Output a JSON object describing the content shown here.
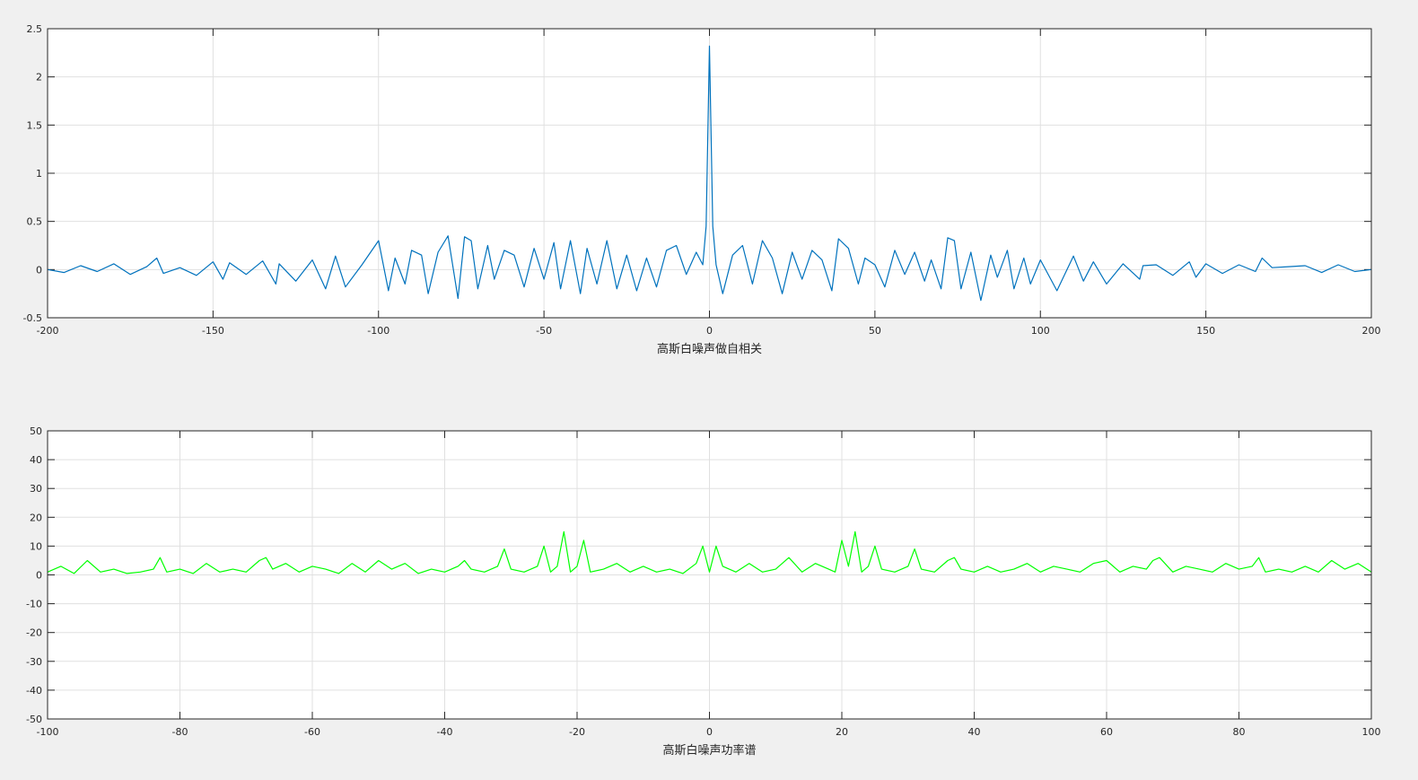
{
  "chart_data": [
    {
      "type": "line",
      "title": "",
      "xlabel": "高斯白噪声做自相关",
      "ylabel": "",
      "xlim": [
        -200,
        200
      ],
      "ylim": [
        -0.5,
        2.5
      ],
      "grid": true,
      "xticks": [
        "-200",
        "-150",
        "-100",
        "-50",
        "0",
        "50",
        "100",
        "150",
        "200"
      ],
      "yticks": [
        "-0.5",
        "0",
        "0.5",
        "1",
        "1.5",
        "2",
        "2.5"
      ],
      "color": "#0072bd",
      "peak": {
        "x": 0,
        "y": 2.32
      },
      "series": [
        {
          "x": [
            -200,
            -195,
            -190,
            -185,
            -180,
            -175,
            -170,
            -167,
            -165,
            -160,
            -155,
            -150,
            -147,
            -145,
            -140,
            -135,
            -131,
            -130,
            -125,
            -120,
            -116,
            -113,
            -110,
            -105,
            -100,
            -97,
            -95,
            -92,
            -90,
            -87,
            -85,
            -82,
            -79,
            -76,
            -74,
            -72,
            -70,
            -67,
            -65,
            -62,
            -59,
            -56,
            -53,
            -50,
            -47,
            -45,
            -42,
            -39,
            -37,
            -34,
            -31,
            -28,
            -25,
            -22,
            -19,
            -16,
            -13,
            -10,
            -7,
            -4,
            -2,
            -1,
            0,
            1,
            2,
            4,
            7,
            10,
            13,
            16,
            19,
            22,
            25,
            28,
            31,
            34,
            37,
            39,
            42,
            45,
            47,
            50,
            53,
            56,
            59,
            62,
            65,
            67,
            70,
            72,
            74,
            76,
            79,
            82,
            85,
            87,
            90,
            92,
            95,
            97,
            100,
            105,
            110,
            113,
            116,
            120,
            125,
            130,
            131,
            135,
            140,
            145,
            147,
            150,
            155,
            160,
            165,
            167,
            170,
            175,
            180,
            185,
            190,
            195,
            200
          ],
          "y": [
            0.0,
            -0.03,
            0.04,
            -0.02,
            0.06,
            -0.05,
            0.03,
            0.12,
            -0.04,
            0.02,
            -0.06,
            0.08,
            -0.1,
            0.07,
            -0.05,
            0.09,
            -0.15,
            0.06,
            -0.12,
            0.1,
            -0.2,
            0.14,
            -0.18,
            0.05,
            0.3,
            -0.22,
            0.12,
            -0.15,
            0.2,
            0.15,
            -0.25,
            0.18,
            0.35,
            -0.3,
            0.34,
            0.3,
            -0.2,
            0.25,
            -0.1,
            0.2,
            0.15,
            -0.18,
            0.22,
            -0.1,
            0.28,
            -0.2,
            0.3,
            -0.25,
            0.22,
            -0.15,
            0.3,
            -0.2,
            0.15,
            -0.22,
            0.12,
            -0.18,
            0.2,
            0.25,
            -0.05,
            0.18,
            0.05,
            0.45,
            2.32,
            0.45,
            0.05,
            -0.25,
            0.15,
            0.25,
            -0.15,
            0.3,
            0.12,
            -0.25,
            0.18,
            -0.1,
            0.2,
            0.1,
            -0.22,
            0.32,
            0.22,
            -0.15,
            0.12,
            0.05,
            -0.18,
            0.2,
            -0.05,
            0.18,
            -0.12,
            0.1,
            -0.2,
            0.33,
            0.3,
            -0.2,
            0.18,
            -0.32,
            0.15,
            -0.08,
            0.2,
            -0.2,
            0.12,
            -0.15,
            0.1,
            -0.22,
            0.14,
            -0.12,
            0.08,
            -0.15,
            0.06,
            -0.1,
            0.04,
            0.05,
            -0.06,
            0.08,
            -0.08,
            0.06,
            -0.04,
            0.05,
            -0.02,
            0.12,
            0.02,
            0.03,
            0.04,
            -0.03,
            0.05,
            -0.02,
            0.0
          ]
        }
      ]
    },
    {
      "type": "line",
      "title": "",
      "xlabel": "高斯白噪声功率谱",
      "ylabel": "",
      "xlim": [
        -100,
        100
      ],
      "ylim": [
        -50,
        50
      ],
      "grid": true,
      "xticks": [
        "-100",
        "-80",
        "-60",
        "-40",
        "-20",
        "0",
        "20",
        "40",
        "60",
        "80",
        "100"
      ],
      "yticks": [
        "-50",
        "-40",
        "-30",
        "-20",
        "-10",
        "0",
        "10",
        "20",
        "30",
        "40",
        "50"
      ],
      "color": "#00ff00",
      "series": [
        {
          "x": [
            -100,
            -98,
            -96,
            -94,
            -92,
            -90,
            -88,
            -86,
            -84,
            -83,
            -82,
            -80,
            -78,
            -76,
            -74,
            -72,
            -70,
            -68,
            -67,
            -66,
            -64,
            -62,
            -60,
            -58,
            -56,
            -54,
            -52,
            -50,
            -48,
            -46,
            -44,
            -42,
            -40,
            -38,
            -37,
            -36,
            -34,
            -32,
            -31,
            -30,
            -28,
            -26,
            -25,
            -24,
            -23,
            -22,
            -21,
            -20,
            -19,
            -18,
            -16,
            -14,
            -12,
            -10,
            -8,
            -6,
            -4,
            -2,
            -1,
            0,
            1,
            2,
            4,
            6,
            8,
            10,
            12,
            14,
            16,
            18,
            19,
            20,
            21,
            22,
            23,
            24,
            25,
            26,
            28,
            30,
            31,
            32,
            34,
            36,
            37,
            38,
            40,
            42,
            44,
            46,
            48,
            50,
            52,
            54,
            56,
            58,
            60,
            62,
            64,
            66,
            67,
            68,
            70,
            72,
            74,
            76,
            78,
            80,
            82,
            83,
            84,
            86,
            88,
            90,
            92,
            94,
            96,
            98,
            100
          ],
          "y": [
            1,
            3,
            0.5,
            5,
            1,
            2,
            0.5,
            1,
            2,
            6,
            1,
            2,
            0.5,
            4,
            1,
            2,
            1,
            5,
            6,
            2,
            4,
            1,
            3,
            2,
            0.5,
            4,
            1,
            5,
            2,
            4,
            0.5,
            2,
            1,
            3,
            5,
            2,
            1,
            3,
            9,
            2,
            1,
            3,
            10,
            1,
            3,
            15,
            1,
            3,
            12,
            1,
            2,
            4,
            1,
            3,
            1,
            2,
            0.5,
            4,
            10,
            1,
            10,
            3,
            1,
            4,
            1,
            2,
            6,
            1,
            4,
            2,
            1,
            12,
            3,
            15,
            1,
            3,
            10,
            2,
            1,
            3,
            9,
            2,
            1,
            5,
            6,
            2,
            1,
            3,
            1,
            2,
            4,
            1,
            3,
            2,
            1,
            4,
            5,
            1,
            3,
            2,
            5,
            6,
            1,
            3,
            2,
            1,
            4,
            2,
            3,
            6,
            1,
            2,
            1,
            3,
            1,
            5,
            2,
            4,
            1
          ]
        }
      ]
    }
  ]
}
